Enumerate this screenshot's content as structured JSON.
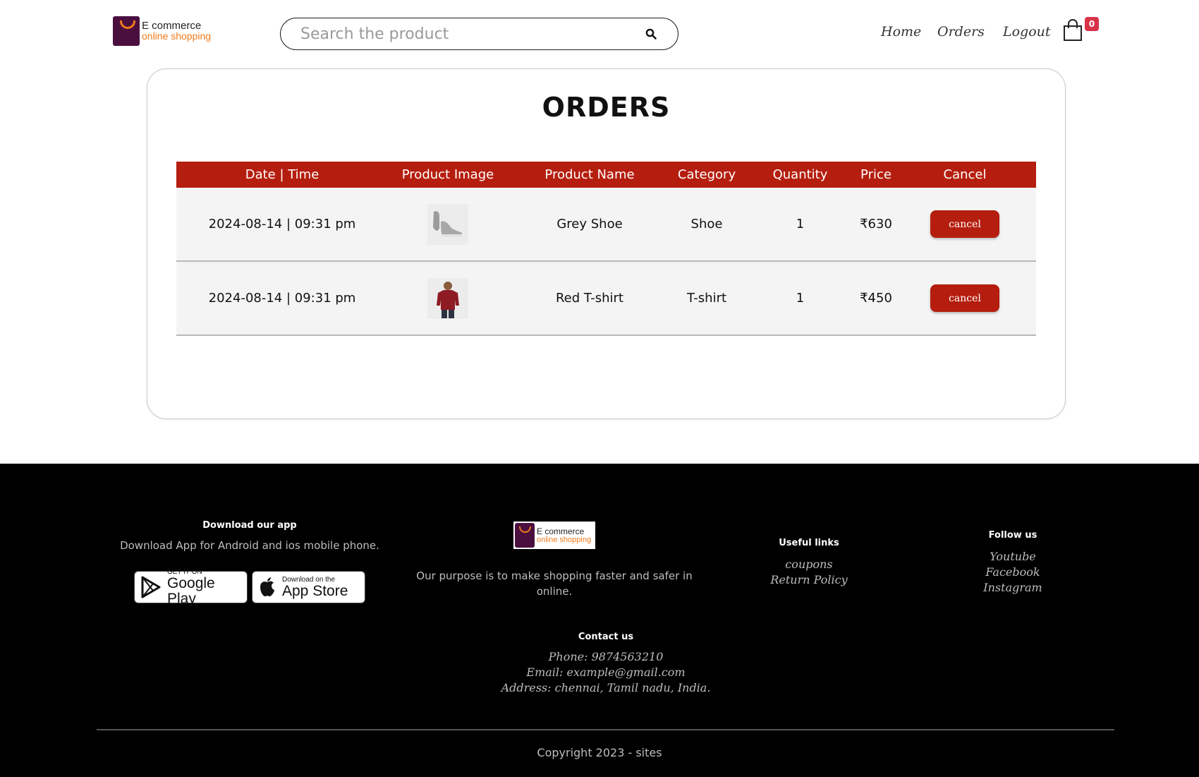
{
  "header": {
    "logo": {
      "line1": "E commerce",
      "line2": "online shopping"
    },
    "search": {
      "placeholder": "Search the product",
      "value": ""
    },
    "nav": {
      "home": "Home",
      "orders": "Orders",
      "logout": "Logout"
    },
    "cart_count": "0",
    "icons": {
      "search": "search-icon",
      "cart": "shopping-bag-icon"
    }
  },
  "orders": {
    "title": "ORDERS",
    "columns": [
      "Date | Time",
      "Product Image",
      "Product Name",
      "Category",
      "Quantity",
      "Price",
      "Cancel"
    ],
    "rows": [
      {
        "datetime": "2024-08-14 | 09:31 pm",
        "image": "grey-shoe-thumbnail",
        "name": "Grey Shoe",
        "category": "Shoe",
        "quantity": "1",
        "price": "₹630",
        "cancel_label": "cancel"
      },
      {
        "datetime": "2024-08-14 | 09:31 pm",
        "image": "red-tshirt-thumbnail",
        "name": "Red T-shirt",
        "category": "T-shirt",
        "quantity": "1",
        "price": "₹450",
        "cancel_label": "cancel"
      }
    ]
  },
  "footer": {
    "download": {
      "heading": "Download our app",
      "text": "Download App for Android and ios mobile phone.",
      "google_play": {
        "small": "GET IT ON",
        "big": "Google Play"
      },
      "app_store": {
        "small": "Download on the",
        "big": "App Store"
      }
    },
    "about": {
      "logo": {
        "line1": "E commerce",
        "line2": "online shopping"
      },
      "text": "Our purpose is to make shopping faster and safer in online."
    },
    "useful_links": {
      "heading": "Useful links",
      "items": [
        "coupons",
        "Return Policy"
      ]
    },
    "follow": {
      "heading": "Follow us",
      "items": [
        "Youtube",
        "Facebook",
        "Instagram"
      ]
    },
    "contact": {
      "heading": "Contact us",
      "phone": "Phone: 9874563210",
      "email": "Email: example@gmail.com",
      "address": "Address: chennai, Tamil nadu, India."
    },
    "copyright": "Copyright 2023 - sites"
  },
  "colors": {
    "accent": "#b51e0f",
    "badge": "#d9334a",
    "brand_purple": "#4a0f3f",
    "brand_orange": "#f07a1b",
    "footer_bg": "#000000"
  }
}
